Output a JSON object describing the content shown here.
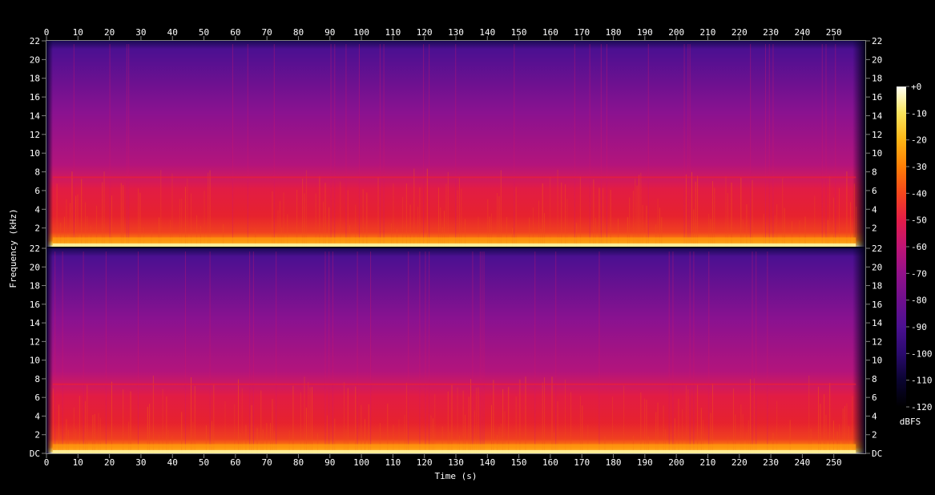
{
  "chart_data": {
    "type": "heatmap",
    "xlabel": "Time (s)",
    "ylabel": "Frequency (kHz)",
    "xlim": [
      0,
      260
    ],
    "x_ticks": [
      "0",
      "10",
      "20",
      "30",
      "40",
      "50",
      "60",
      "70",
      "80",
      "90",
      "100",
      "110",
      "120",
      "130",
      "140",
      "150",
      "160",
      "170",
      "180",
      "190",
      "200",
      "210",
      "220",
      "230",
      "240",
      "250"
    ],
    "channels": [
      {
        "ylim": [
          0,
          22
        ],
        "y_ticks_left": [
          "2",
          "4",
          "6",
          "8",
          "10",
          "12",
          "14",
          "16",
          "18",
          "20",
          "22"
        ],
        "y_ticks_right": [
          "22",
          "20",
          "18",
          "16",
          "14",
          "12",
          "10",
          "8",
          "6",
          "4",
          "2"
        ]
      },
      {
        "ylim": [
          0,
          22
        ],
        "y_ticks_left": [
          "DC",
          "2",
          "4",
          "6",
          "8",
          "10",
          "12",
          "14",
          "16",
          "18",
          "20",
          "22"
        ],
        "y_ticks_right": [
          "DC",
          "2",
          "4",
          "6",
          "8",
          "10",
          "12",
          "14",
          "16",
          "18",
          "20",
          "22"
        ]
      }
    ],
    "colorbar": {
      "label": "dBFS",
      "range": [
        -120,
        0
      ],
      "ticks": [
        "+0",
        "-10",
        "-20",
        "-30",
        "-40",
        "-50",
        "-60",
        "-70",
        "-80",
        "-90",
        "-100",
        "-110",
        "-120"
      ],
      "colors": [
        "#000000",
        "#0a0430",
        "#2a0a6e",
        "#4b1091",
        "#6e0f8e",
        "#93118a",
        "#c01475",
        "#e41c48",
        "#f6471c",
        "#fd7e06",
        "#fdb515",
        "#f9e45c",
        "#fffff4"
      ]
    },
    "energy_profile": [
      {
        "freq_khz": 0,
        "level_dbfs": -15
      },
      {
        "freq_khz": 2,
        "level_dbfs": -42
      },
      {
        "freq_khz": 6,
        "level_dbfs": -55
      },
      {
        "freq_khz": 7.5,
        "level_dbfs": -58
      },
      {
        "freq_khz": 12,
        "level_dbfs": -65
      },
      {
        "freq_khz": 21.5,
        "level_dbfs": -75
      },
      {
        "freq_khz": 22,
        "level_dbfs": -120
      }
    ],
    "active_time_range": [
      2,
      257
    ],
    "grid": false,
    "legend": "colorbar right"
  }
}
